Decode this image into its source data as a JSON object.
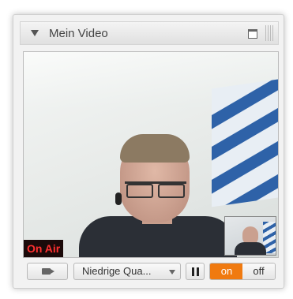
{
  "panel": {
    "title": "Mein Video"
  },
  "video": {
    "status_label": "On Air"
  },
  "controls": {
    "quality_value": "Niedrige Qua...",
    "toggle_on_label": "on",
    "toggle_off_label": "off"
  },
  "icons": [
    "collapse-icon",
    "window-icon",
    "grip-icon",
    "camera-icon",
    "pause-icon",
    "chevron-down-icon"
  ],
  "colors": {
    "accent": "#f07a10",
    "on_air_text": "#ff3030"
  }
}
